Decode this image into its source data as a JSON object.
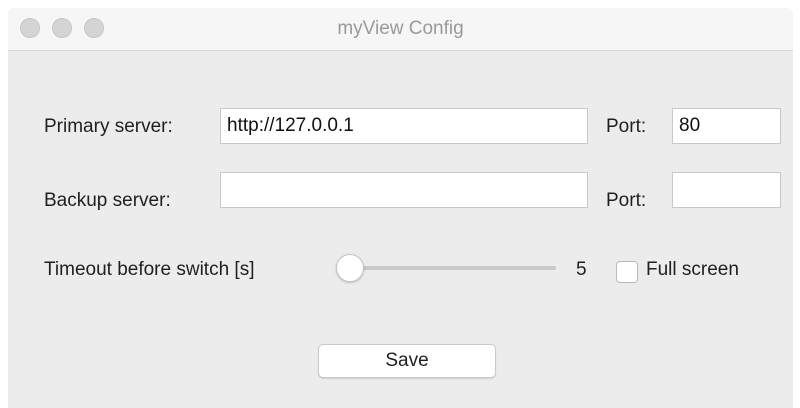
{
  "window": {
    "title": "myView Config"
  },
  "primary": {
    "label": "Primary server:",
    "value": "http://127.0.0.1",
    "port_label": "Port:",
    "port_value": "80"
  },
  "backup": {
    "label": "Backup server:",
    "value": "",
    "port_label": "Port:",
    "port_value": ""
  },
  "timeout": {
    "label": "Timeout before switch [s]",
    "value": "5",
    "slider_fraction": 0.0
  },
  "fullscreen": {
    "label": "Full screen",
    "checked": false
  },
  "save": {
    "label": "Save"
  },
  "colors": {
    "window_bg": "#ececec",
    "titlebar_bg": "#f6f6f6",
    "title_text": "#9a9a9a"
  }
}
